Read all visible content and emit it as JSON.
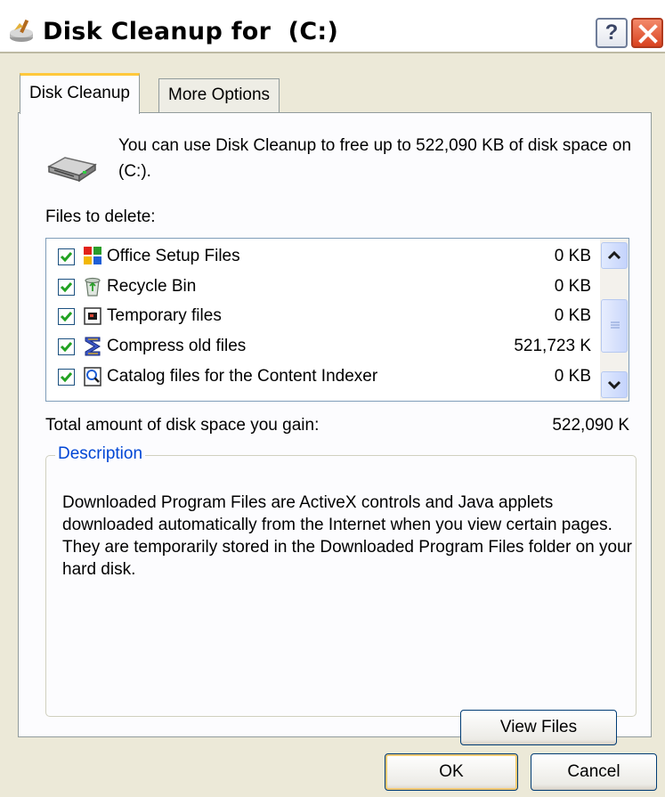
{
  "window": {
    "title": "Disk Cleanup for  (C:)",
    "help_label": "?"
  },
  "tabs": [
    {
      "label": "Disk Cleanup",
      "active": true
    },
    {
      "label": "More Options",
      "active": false
    }
  ],
  "intro_text": "You can use Disk Cleanup to free up to 522,090 KB of disk space on  (C:).",
  "files_label": "Files to delete:",
  "files": [
    {
      "label": "Office Setup Files",
      "size": "0 KB",
      "checked": true,
      "icon": "office-setup-icon"
    },
    {
      "label": "Recycle Bin",
      "size": "0 KB",
      "checked": true,
      "icon": "recycle-bin-icon"
    },
    {
      "label": "Temporary files",
      "size": "0 KB",
      "checked": true,
      "icon": "temporary-files-icon"
    },
    {
      "label": "Compress old files",
      "size": "521,723 K",
      "checked": true,
      "icon": "compress-icon"
    },
    {
      "label": "Catalog files for the Content Indexer",
      "size": "0 KB",
      "checked": true,
      "icon": "catalog-icon"
    }
  ],
  "total": {
    "label": "Total amount of disk space you gain:",
    "value": "522,090 K"
  },
  "description": {
    "legend": "Description",
    "text": "Downloaded Program Files are ActiveX controls and Java applets downloaded automatically from the Internet when you view certain pages. They are temporarily stored in the Downloaded Program Files folder on your hard disk."
  },
  "buttons": {
    "view_files": "View Files",
    "ok": "OK",
    "cancel": "Cancel"
  },
  "colors": {
    "dialog_bg": "#ece9d8",
    "legend_blue": "#0046d5",
    "close_red": "#d9421f",
    "check_green": "#21a121",
    "active_tab_accent": "#ffc83c"
  }
}
